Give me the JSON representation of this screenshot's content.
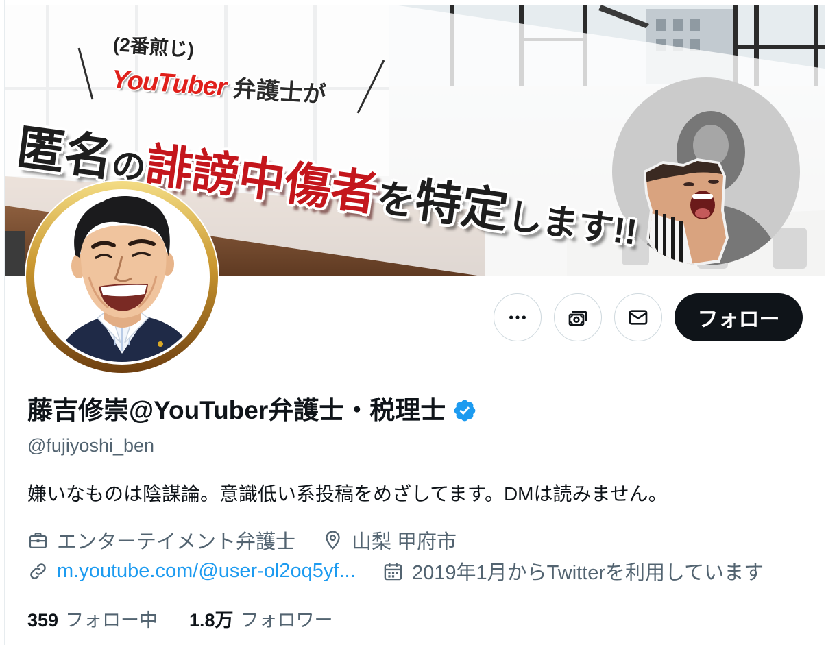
{
  "banner": {
    "tag_small": "(2番煎じ)",
    "tag_youtuber": "YouTuber",
    "tag_suffix": "弁護士が",
    "headline": [
      "匿名",
      "の",
      "誹謗中傷者",
      "を",
      "特定",
      "します!!"
    ]
  },
  "actions": {
    "follow_label": "フォロー"
  },
  "profile": {
    "name": "藤吉修崇@YouTuber弁護士・税理士",
    "verified": true,
    "handle": "@fujiyoshi_ben",
    "bio": "嫌いなものは陰謀論。意識低い系投稿をめざしてます。DMは読みません。",
    "category": "エンターテイメント弁護士",
    "location": "山梨 甲府市",
    "url_text": "m.youtube.com/@user-ol2oq5yf...",
    "joined": "2019年1月からTwitterを利用しています"
  },
  "stats": {
    "following_count": "359",
    "following_label": "フォロー中",
    "followers_count": "1.8万",
    "followers_label": "フォロワー"
  },
  "icons": {
    "more": "more-horizontal-icon",
    "subscribe": "subscription-icon",
    "message": "mail-icon",
    "verified": "verified-badge-icon",
    "category": "briefcase-icon",
    "location": "location-pin-icon",
    "url": "link-icon",
    "joined": "calendar-icon"
  },
  "colors": {
    "text": "#0f1419",
    "secondary": "#536471",
    "link": "#1d9bf0",
    "verified": "#1d9bf0",
    "follow_button": "#0f1419",
    "headline_red": "#c4161c",
    "youtuber_red": "#e0201b"
  }
}
